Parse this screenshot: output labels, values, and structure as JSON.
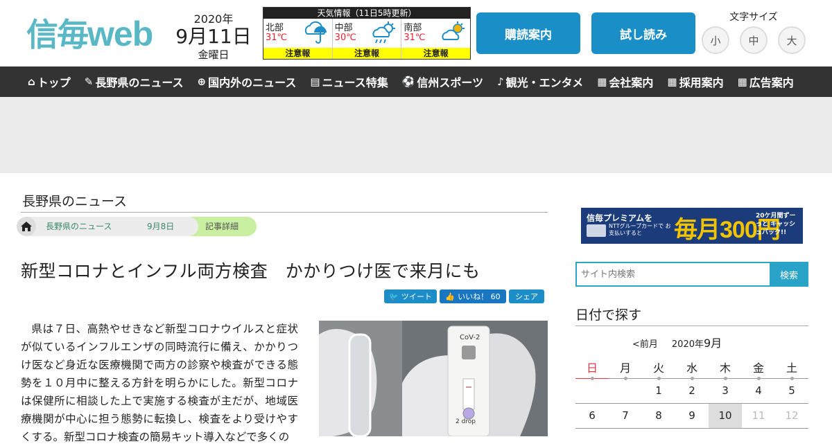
{
  "header": {
    "logo_kanji": "信毎",
    "logo_web": "web",
    "date_year": "2020年",
    "date_md": "9月11日",
    "date_dow": "金曜日",
    "weather": {
      "title": "天気情報（11日5時更新）",
      "regions": [
        {
          "name": "北部",
          "temp": "31℃",
          "icon": "umbrella-cloud-icon",
          "warn": "注意報"
        },
        {
          "name": "中部",
          "temp": "30℃",
          "icon": "sun-cloud-rain-icon",
          "warn": "注意報"
        },
        {
          "name": "南部",
          "temp": "31℃",
          "icon": "sun-cloud-icon",
          "warn": "注意報"
        }
      ]
    },
    "subscribe_label": "購読案内",
    "trial_label": "試し読み",
    "fontsize_label": "文字サイズ",
    "fontsize_small": "小",
    "fontsize_medium": "中",
    "fontsize_large": "大"
  },
  "nav": {
    "items": [
      {
        "icon": "home-icon",
        "glyph": "⌂",
        "label": "トップ"
      },
      {
        "icon": "brush-icon",
        "glyph": "✎",
        "label": "長野県のニュース"
      },
      {
        "icon": "globe-icon",
        "glyph": "⊕",
        "label": "国内外のニュース"
      },
      {
        "icon": "document-icon",
        "glyph": "▤",
        "label": "ニュース特集"
      },
      {
        "icon": "sports-icon",
        "glyph": "⚽",
        "label": "信州スポーツ"
      },
      {
        "icon": "guitar-icon",
        "glyph": "♪",
        "label": "観光・エンタメ"
      },
      {
        "icon": "building-icon",
        "glyph": "▦",
        "label": "会社案内"
      },
      {
        "icon": "building-icon",
        "glyph": "▦",
        "label": "採用案内"
      },
      {
        "icon": "building-icon",
        "glyph": "▦",
        "label": "広告案内"
      }
    ]
  },
  "main": {
    "section_title": "長野県のニュース",
    "breadcrumb": [
      "長野県のニュース",
      "9月8日",
      "記事詳細"
    ],
    "headline": "新型コロナとインフル両方検査　かかりつけ医で来月にも",
    "social": {
      "tweet": "ツイート",
      "like": "いいね！ 60",
      "share": "シェア"
    },
    "article_text": "県は７日、高熱やせきなど新型コロナウイルスと症状が似ているインフルエンザの同時流行に備え、かかりつけ医など身近な医療機関で両方の診察や検査ができる態勢を１０月中に整える方針を明らかにした。新型コロナは保健所に相談した上で実施する検査が主だが、地域医療機関が中心に担う態勢に転換し、検査をより受けやすくする。新型コロナ検査の簡易キット導入などで多くの",
    "photo_text": {
      "brand": "CoV-2",
      "drop": "2 drop"
    }
  },
  "sidebar": {
    "promo": {
      "line1": "信毎プレミアムを",
      "line2": "NTTグループカードで お支払いすると",
      "big": "毎月300円",
      "line3": "20ケ月間ずーっと キャッシュバック!!"
    },
    "search": {
      "placeholder": "サイト内検索",
      "button": "検索"
    },
    "calendar": {
      "title": "日付で探す",
      "prev": "<前月",
      "year_month_year": "2020年",
      "year_month_month": "9月",
      "weekdays": [
        "日",
        "月",
        "火",
        "水",
        "木",
        "金",
        "土"
      ],
      "rows": [
        [
          "",
          "",
          "1",
          "2",
          "3",
          "4",
          "5"
        ],
        [
          "6",
          "7",
          "8",
          "9",
          "10",
          "11",
          "12"
        ]
      ],
      "today": "10"
    }
  },
  "colors": {
    "brand": "#5ab8c6",
    "button": "#1a8ec7",
    "nav": "#333333",
    "warn": "#ffff00",
    "sunday": "#ee3344"
  }
}
